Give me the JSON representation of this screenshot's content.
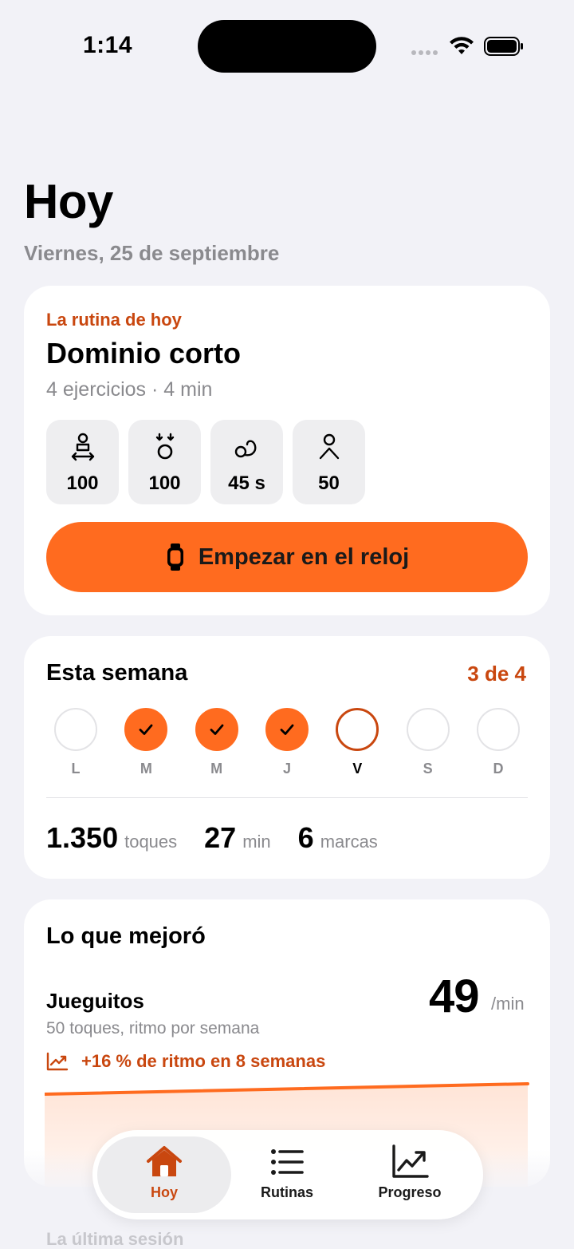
{
  "status_bar": {
    "time": "1:14"
  },
  "header": {
    "title": "Hoy",
    "date": "Viernes, 25 de septiembre"
  },
  "routine": {
    "eyebrow": "La rutina de hoy",
    "name": "Dominio corto",
    "meta": "4 ejercicios · 4 min",
    "tiles": [
      {
        "icon": "juggle-icon",
        "value": "100"
      },
      {
        "icon": "ball-drop-icon",
        "value": "100"
      },
      {
        "icon": "ball-curve-icon",
        "value": "45 s"
      },
      {
        "icon": "person-icon",
        "value": "50"
      }
    ],
    "start_label": "Empezar en el reloj"
  },
  "week": {
    "title": "Esta semana",
    "count": "3 de 4",
    "days": [
      {
        "label": "L",
        "state": "empty"
      },
      {
        "label": "M",
        "state": "done"
      },
      {
        "label": "M",
        "state": "done"
      },
      {
        "label": "J",
        "state": "done"
      },
      {
        "label": "V",
        "state": "today"
      },
      {
        "label": "S",
        "state": "empty"
      },
      {
        "label": "D",
        "state": "empty"
      }
    ],
    "stats": [
      {
        "value": "1.350",
        "unit": "toques"
      },
      {
        "value": "27",
        "unit": "min"
      },
      {
        "value": "6",
        "unit": "marcas"
      }
    ]
  },
  "improved": {
    "title": "Lo que mejoró",
    "name": "Jueguitos",
    "desc": "50 toques, ritmo por semana",
    "value": "49",
    "unit": "/min",
    "trend": "+16 % de ritmo en 8 semanas"
  },
  "next_section": "La última sesión",
  "tabbar": {
    "tabs": [
      {
        "label": "Hoy",
        "active": true
      },
      {
        "label": "Rutinas",
        "active": false
      },
      {
        "label": "Progreso",
        "active": false
      }
    ]
  },
  "colors": {
    "accent": "#ff6b1f",
    "accent_text": "#c9470f",
    "background": "#f2f2f7"
  }
}
